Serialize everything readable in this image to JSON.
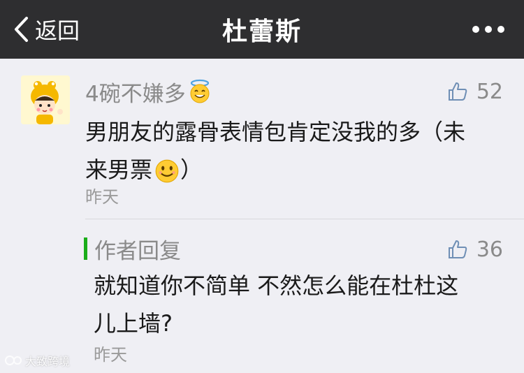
{
  "navbar": {
    "back_label": "返回",
    "title": "杜蕾斯",
    "more_icon": "more-icon"
  },
  "comment": {
    "nickname": "4碗不嫌多",
    "nickname_emoji": "halo-smile-emoji",
    "likes": "52",
    "text_line1": "男朋友的露骨表情包肯定没我的多（未",
    "text_line2_prefix": "来男票",
    "text_line2_emoji": "smile-emoji",
    "text_line2_suffix": "）",
    "time": "昨天"
  },
  "reply": {
    "label": "作者回复",
    "likes": "36",
    "text_line1": "就知道你不简单 不然怎么能在杜杜这",
    "text_line2": "儿上墙?",
    "time": "昨天"
  },
  "watermark": "大致跨境",
  "colors": {
    "navbar": "#2e2e30",
    "background": "#efeff4",
    "reply_accent": "#1aad19"
  }
}
